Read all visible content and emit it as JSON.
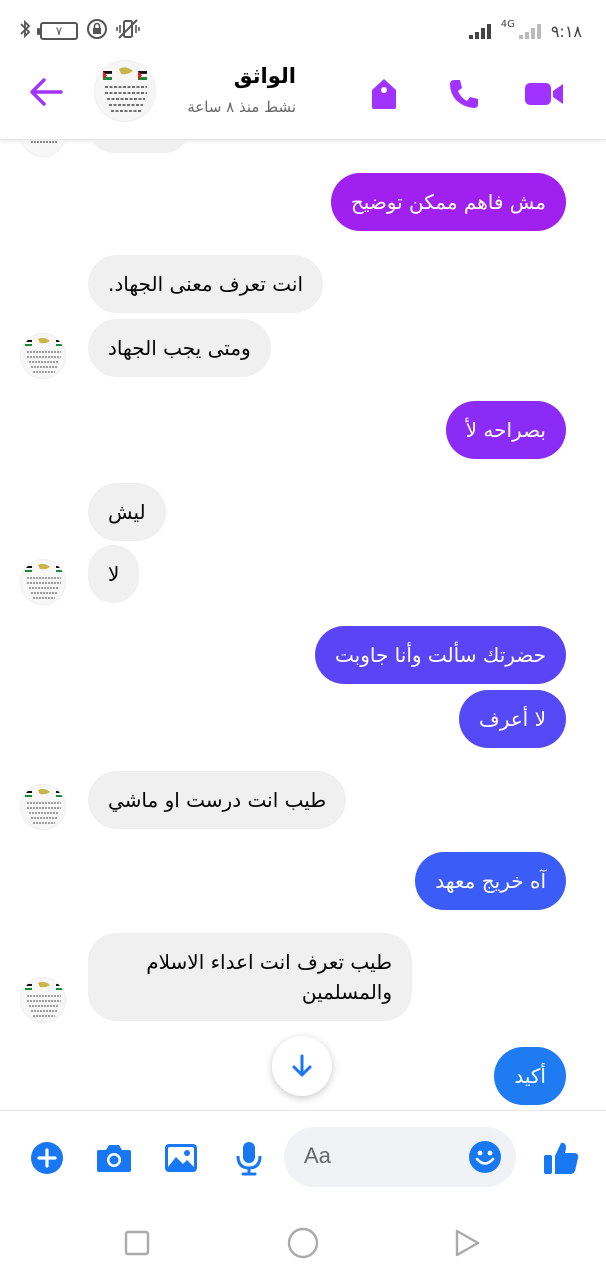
{
  "status_bar": {
    "time": "٩:١٨",
    "battery": "٧",
    "network": "4G"
  },
  "header": {
    "contact_name": "الواثق",
    "contact_status": "نشط منذ ٨ ساعة",
    "icons": [
      "back-arrow-icon",
      "tag-icon",
      "phone-icon",
      "video-icon"
    ],
    "accent_color": "#a033ff"
  },
  "messages": [
    {
      "dir": "in",
      "text": "",
      "partial": true
    },
    {
      "dir": "out",
      "text": "مش فاهم ممكن توضيح",
      "color": "#a020f0"
    },
    {
      "dir": "in",
      "text": "انت تعرف معنى الجهاد."
    },
    {
      "dir": "in",
      "text": "ومتى يجب الجهاد"
    },
    {
      "dir": "out",
      "text": "بصراحه لأ",
      "color": "#8a2cf5"
    },
    {
      "dir": "in",
      "text": "ليش"
    },
    {
      "dir": "in",
      "text": "لا"
    },
    {
      "dir": "out",
      "text": "حضرتك سألت وأنا جاوبت",
      "color": "#5b44f5"
    },
    {
      "dir": "out",
      "text": "لا أعرف",
      "color": "#5548f5"
    },
    {
      "dir": "in",
      "text": "طيب انت درست او ماشي"
    },
    {
      "dir": "out",
      "text": "آه خريج معهد",
      "color": "#3b5cf6"
    },
    {
      "dir": "in",
      "text": "طيب تعرف انت اعداء الاسلام",
      "text2": "والمسلمين"
    },
    {
      "dir": "out",
      "text": "أكيد",
      "color": "#1e7bf2"
    }
  ],
  "composer": {
    "placeholder": "Aa",
    "icons": [
      "plus-icon",
      "camera-icon",
      "gallery-icon",
      "mic-icon",
      "emoji-icon",
      "like-icon"
    ],
    "accent_color": "#1877f2"
  },
  "nav": {
    "icons": [
      "recents-square-icon",
      "home-circle-icon",
      "back-triangle-icon"
    ]
  }
}
